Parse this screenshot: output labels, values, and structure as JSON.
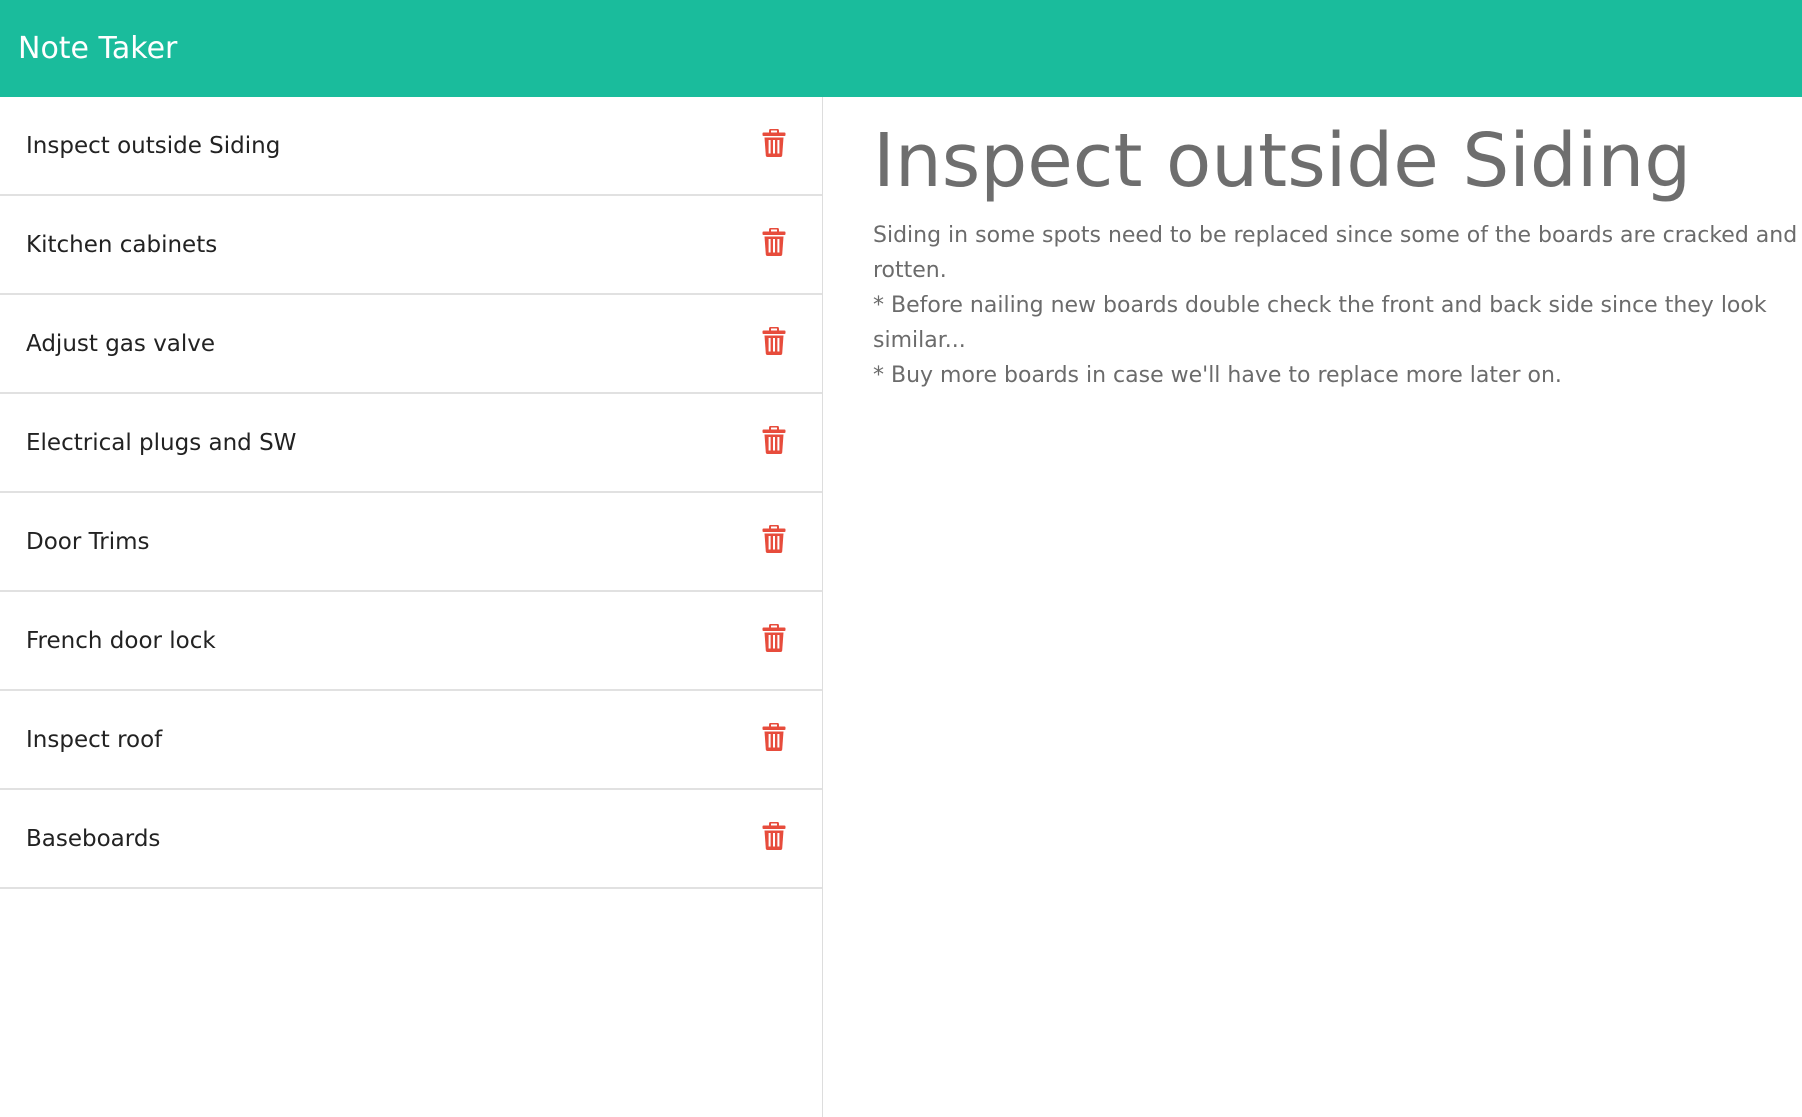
{
  "app": {
    "title": "Note Taker"
  },
  "colors": {
    "navbar": "#1abc9c",
    "delete_icon": "#e74c3c"
  },
  "notes": [
    {
      "title": "Inspect outside Siding",
      "icon": "trash-icon"
    },
    {
      "title": "Kitchen cabinets",
      "icon": "trash-icon"
    },
    {
      "title": "Adjust gas valve",
      "icon": "trash-icon"
    },
    {
      "title": "Electrical plugs and SW",
      "icon": "trash-icon"
    },
    {
      "title": "Door Trims",
      "icon": "trash-icon"
    },
    {
      "title": "French door lock",
      "icon": "trash-icon"
    },
    {
      "title": "Inspect roof",
      "icon": "trash-icon"
    },
    {
      "title": "Baseboards",
      "icon": "trash-icon"
    }
  ],
  "active_note": {
    "title": "Inspect outside Siding",
    "text": "Siding in some spots need to be replaced since some of the boards are cracked and rotten.\n* Before nailing new boards double check the front and back side since they look similar...\n* Buy more boards in case we'll have to replace more later on."
  }
}
